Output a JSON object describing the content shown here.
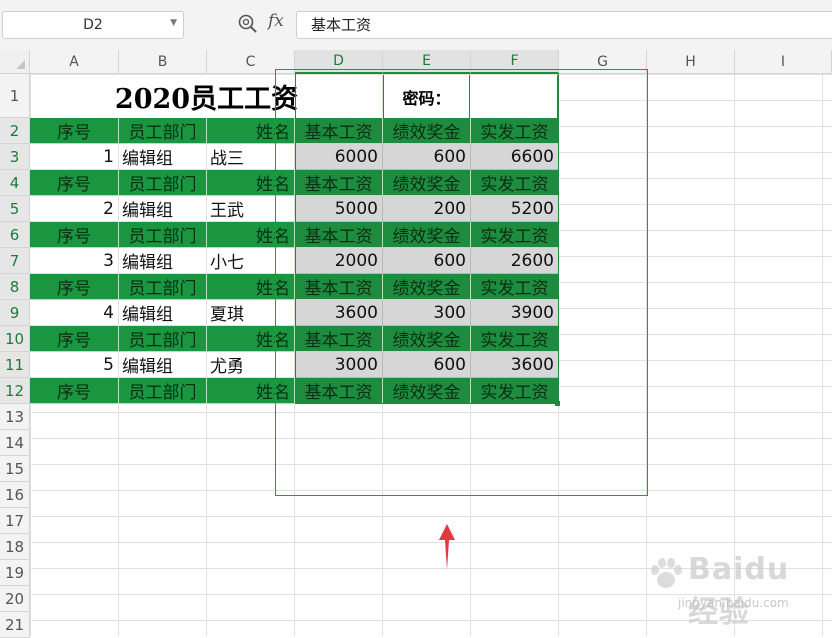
{
  "formula_bar": {
    "cell_ref": "D2",
    "fx_label": "fx",
    "formula": "基本工资"
  },
  "columns": [
    "A",
    "B",
    "C",
    "D",
    "E",
    "F",
    "G",
    "H",
    "I"
  ],
  "rows": [
    "1",
    "2",
    "3",
    "4",
    "5",
    "6",
    "7",
    "8",
    "9",
    "10",
    "11",
    "12",
    "13",
    "14",
    "15",
    "16",
    "17",
    "18",
    "19",
    "20",
    "21"
  ],
  "sheet": {
    "title": "2020员工工资",
    "password_label": "密码：",
    "password_value": "",
    "header": [
      "序号",
      "员工部门",
      "姓名",
      "基本工资",
      "绩效奖金",
      "实发工资"
    ],
    "records": [
      {
        "no": "1",
        "dept": "编辑组",
        "name": "战三",
        "base": "6000",
        "bonus": "600",
        "total": "6600"
      },
      {
        "no": "2",
        "dept": "编辑组",
        "name": "王武",
        "base": "5000",
        "bonus": "200",
        "total": "5200"
      },
      {
        "no": "3",
        "dept": "编辑组",
        "name": "小七",
        "base": "2000",
        "bonus": "600",
        "total": "2600"
      },
      {
        "no": "4",
        "dept": "编辑组",
        "name": "夏琪",
        "base": "3600",
        "bonus": "300",
        "total": "3900"
      },
      {
        "no": "5",
        "dept": "编辑组",
        "name": "尤勇",
        "base": "3000",
        "bonus": "600",
        "total": "3600"
      }
    ]
  },
  "watermark": {
    "brand": "Baidu经验",
    "url": "jingyan.baidu.com"
  },
  "colors": {
    "header_green": "#1a9641",
    "selection_green": "#1e8a3e",
    "annotation_red": "#e0393e"
  }
}
